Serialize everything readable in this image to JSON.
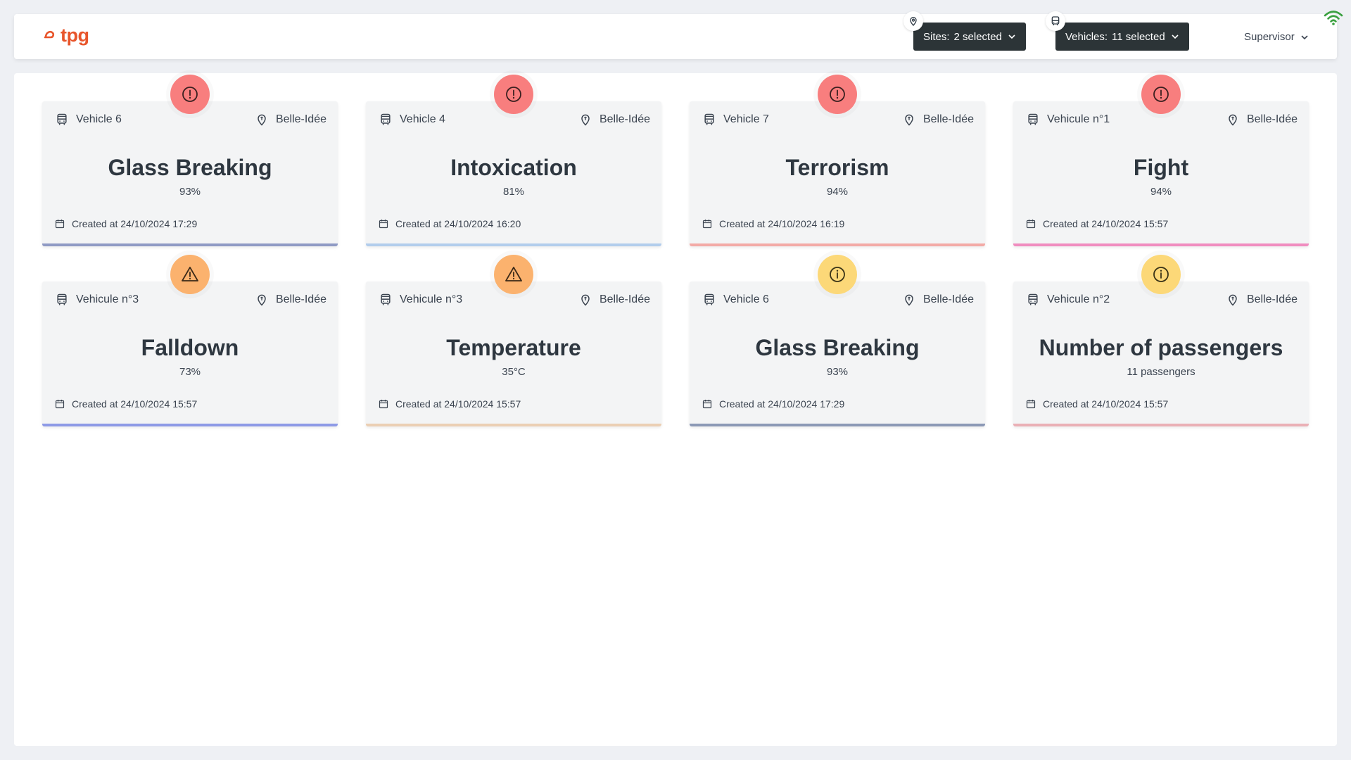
{
  "header": {
    "logo_text": "tpg",
    "sites_filter": {
      "label": "Sites:",
      "value": "2 selected"
    },
    "vehicles_filter": {
      "label": "Vehicles:",
      "value": "11 selected"
    },
    "user_role": "Supervisor",
    "icons": [
      "pin-icon",
      "bus-icon",
      "wifi-icon"
    ]
  },
  "colors": {
    "brand": "#e8552b",
    "critical": "#f87e7e",
    "warning": "#fbb26e",
    "info": "#fcd878"
  },
  "alerts": [
    {
      "vehicle": "Vehicle 6",
      "site": "Belle-Idée",
      "title": "Glass Breaking",
      "value": "93%",
      "created": "Created at 24/10/2024 17:29",
      "severity": "critical",
      "accent_color": "#8f9ac4"
    },
    {
      "vehicle": "Vehicle 4",
      "site": "Belle-Idée",
      "title": "Intoxication",
      "value": "81%",
      "created": "Created at 24/10/2024 16:20",
      "severity": "critical",
      "accent_color": "#b2cdec"
    },
    {
      "vehicle": "Vehicle 7",
      "site": "Belle-Idée",
      "title": "Terrorism",
      "value": "94%",
      "created": "Created at 24/10/2024 16:19",
      "severity": "critical",
      "accent_color": "#f3aaa6"
    },
    {
      "vehicle": "Vehicule n°1",
      "site": "Belle-Idée",
      "title": "Fight",
      "value": "94%",
      "created": "Created at 24/10/2024 15:57",
      "severity": "critical",
      "accent_color": "#f08cbf"
    },
    {
      "vehicle": "Vehicule n°3",
      "site": "Belle-Idée",
      "title": "Falldown",
      "value": "73%",
      "created": "Created at 24/10/2024 15:57",
      "severity": "warning",
      "accent_color": "#8e9ae6"
    },
    {
      "vehicle": "Vehicule n°3",
      "site": "Belle-Idée",
      "title": "Temperature",
      "value": "35°C",
      "created": "Created at 24/10/2024 15:57",
      "severity": "warning",
      "accent_color": "#ebcfb4"
    },
    {
      "vehicle": "Vehicle 6",
      "site": "Belle-Idée",
      "title": "Glass Breaking",
      "value": "93%",
      "created": "Created at 24/10/2024 17:29",
      "severity": "info",
      "accent_color": "#8c99b6"
    },
    {
      "vehicle": "Vehicule n°2",
      "site": "Belle-Idée",
      "title": "Number of passengers",
      "value": "11 passengers",
      "created": "Created at 24/10/2024 15:57",
      "severity": "info",
      "accent_color": "#eab0b6"
    }
  ]
}
